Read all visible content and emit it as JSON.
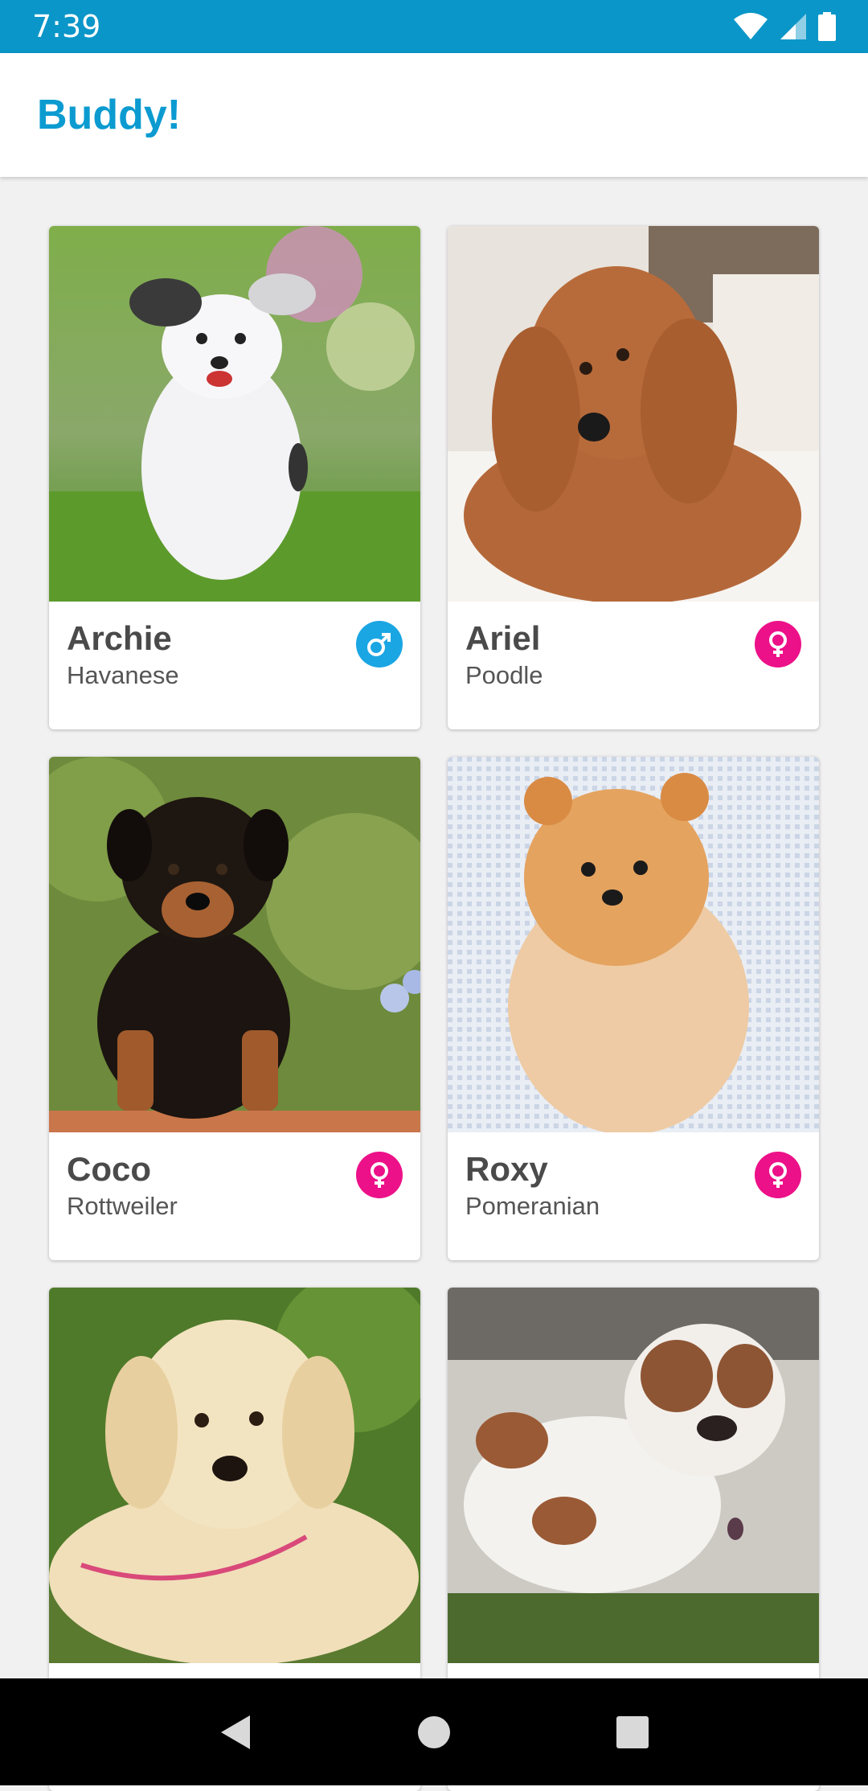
{
  "status_bar": {
    "time": "7:39"
  },
  "app_bar": {
    "title": "Buddy!"
  },
  "dogs": [
    {
      "name": "Archie",
      "breed": "Havanese",
      "gender": "male"
    },
    {
      "name": "Ariel",
      "breed": "Poodle",
      "gender": "female"
    },
    {
      "name": "Coco",
      "breed": "Rottweiler",
      "gender": "female"
    },
    {
      "name": "Roxy",
      "breed": "Pomeranian",
      "gender": "female"
    },
    {
      "name": "",
      "breed": "",
      "gender": ""
    },
    {
      "name": "",
      "breed": "",
      "gender": ""
    }
  ],
  "colors": {
    "primary": "#0a96c8",
    "title": "#0b9bd0",
    "male": "#1aa6e3",
    "female": "#ec1188"
  },
  "icons": {
    "wifi": "wifi-icon",
    "signal": "signal-icon",
    "battery": "battery-icon",
    "male": "male-icon",
    "female": "female-icon",
    "back": "back-icon",
    "home": "home-icon",
    "recents": "recents-icon"
  }
}
